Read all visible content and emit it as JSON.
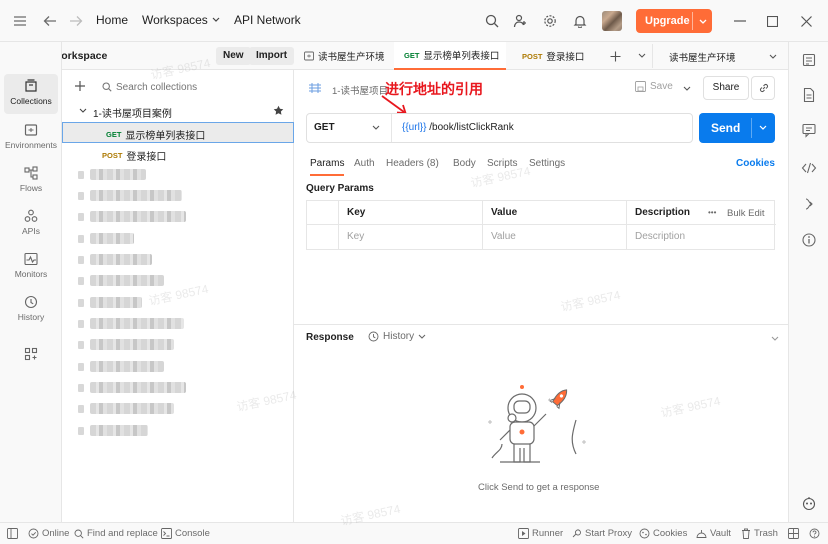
{
  "topbar": {
    "home": "Home",
    "workspaces": "Workspaces",
    "api_network": "API Network",
    "upgrade": "Upgrade"
  },
  "rail": {
    "items": [
      {
        "label": "Collections",
        "icon": "collections-icon"
      },
      {
        "label": "Environments",
        "icon": "environments-icon"
      },
      {
        "label": "Flows",
        "icon": "flows-icon"
      },
      {
        "label": "APIs",
        "icon": "apis-icon"
      },
      {
        "label": "Monitors",
        "icon": "monitors-icon"
      },
      {
        "label": "History",
        "icon": "history-icon"
      }
    ]
  },
  "workspace": {
    "name": "My Workspace",
    "new_label": "New",
    "import_label": "Import"
  },
  "sidebar": {
    "search_placeholder": "Search collections",
    "collection_name": "1-读书屋项目案例",
    "requests": [
      {
        "method": "GET",
        "name": "显示榜单列表接口"
      },
      {
        "method": "POST",
        "name": "登录接口"
      }
    ]
  },
  "tabs": [
    {
      "method": "",
      "name": "读书屋生产环境"
    },
    {
      "method": "GET",
      "name": "显示榜单列表接口"
    },
    {
      "method": "POST",
      "name": "登录接口"
    }
  ],
  "env_selector": "读书屋生产环境",
  "request": {
    "breadcrumb": "1-读书屋项目",
    "annotation": "进行地址的引用",
    "save_label": "Save",
    "share_label": "Share",
    "method": "GET",
    "url_var": "{{url}}",
    "url_path": " /book/listClickRank",
    "send_label": "Send",
    "tabs": [
      "Params",
      "Auth",
      "Headers (8)",
      "Body",
      "Scripts",
      "Settings"
    ],
    "cookies": "Cookies",
    "query_params_title": "Query Params",
    "columns": {
      "key": "Key",
      "value": "Value",
      "description": "Description",
      "bulk_edit": "Bulk Edit",
      "more": "•••"
    },
    "placeholders": {
      "key": "Key",
      "value": "Value",
      "description": "Description"
    }
  },
  "response": {
    "title": "Response",
    "history": "History",
    "empty_text": "Click Send to get a response"
  },
  "statusbar": {
    "online": "Online",
    "find_replace": "Find and replace",
    "console": "Console",
    "runner": "Runner",
    "start_proxy": "Start Proxy",
    "cookies": "Cookies",
    "vault": "Vault",
    "trash": "Trash"
  },
  "watermark": "访客 98574",
  "colors": {
    "accent": "#ff6c37",
    "send_blue": "#097bed",
    "get_green": "#007f31",
    "post_amber": "#ad7a03",
    "annotation_red": "#e8171e",
    "url_var": "#1a73e8"
  }
}
